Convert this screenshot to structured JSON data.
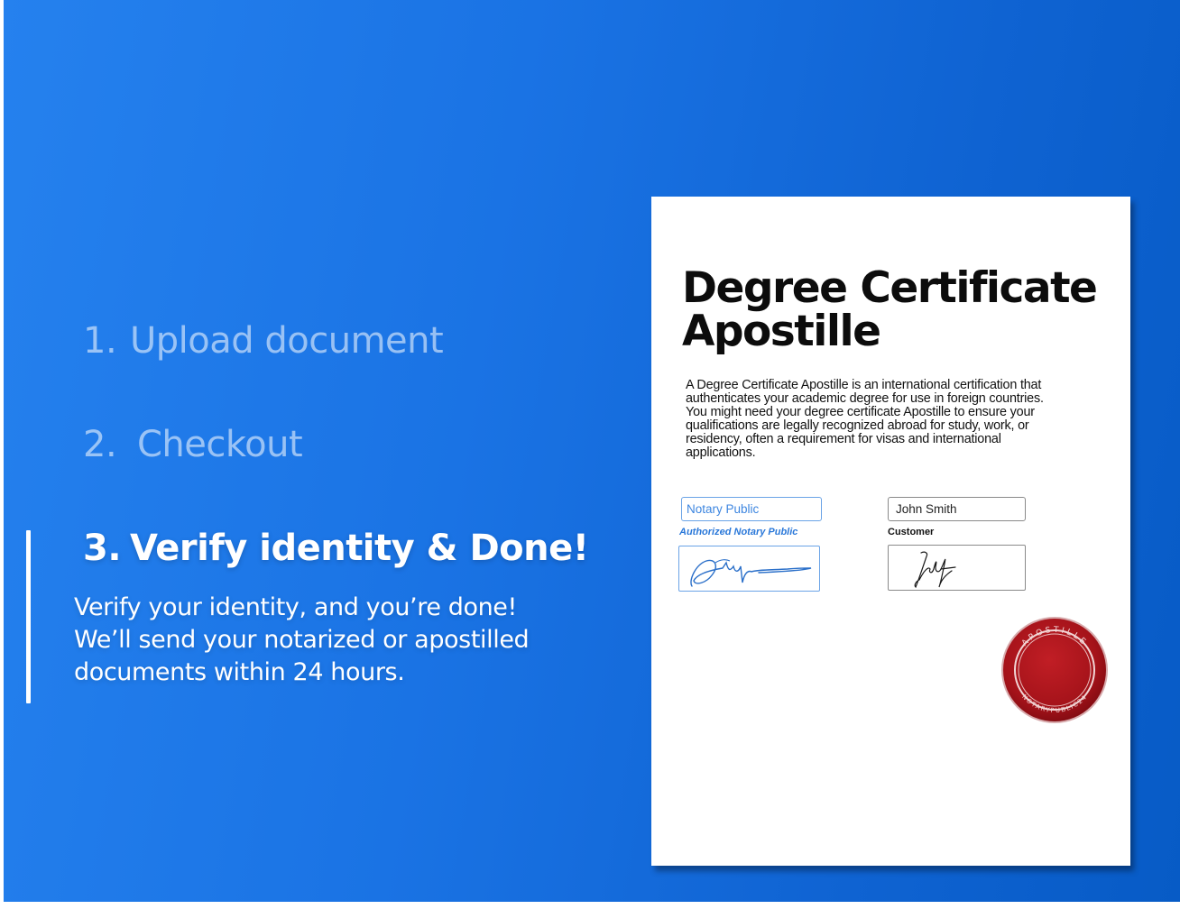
{
  "steps": [
    {
      "number": "1.",
      "label": "Upload document",
      "active": false
    },
    {
      "number": "2.",
      "label": "Checkout",
      "active": false
    },
    {
      "number": "3.",
      "label": "Verify identity & Done!",
      "active": true
    }
  ],
  "active_step_description": {
    "line1": "Verify your identity, and you’re done!",
    "line2": "We’ll send your notarized or apostilled",
    "line3": "documents within 24 hours."
  },
  "document": {
    "title_line1": "Degree Certificate",
    "title_line2": "Apostille",
    "body_lines": [
      "A Degree Certificate Apostille is an international certification that",
      "authenticates your academic degree for use in foreign countries.",
      "You might need your degree certificate Apostille to ensure your",
      "qualifications are legally recognized abroad for study, work, or",
      "residency, often a requirement for visas and international",
      "applications."
    ],
    "notary": {
      "field_value": "Notary Public",
      "label": "Authorized Notary Public"
    },
    "customer": {
      "field_value": "John Smith",
      "label": "Customer"
    },
    "seal": {
      "top_text": "APOSTILLE",
      "bottom_text": "NOTARYPUBLIC24"
    }
  },
  "colors": {
    "background_start": "#2581ee",
    "background_end": "#075bc6",
    "notary_accent": "#2a78d9",
    "seal_red": "#b3161c"
  }
}
